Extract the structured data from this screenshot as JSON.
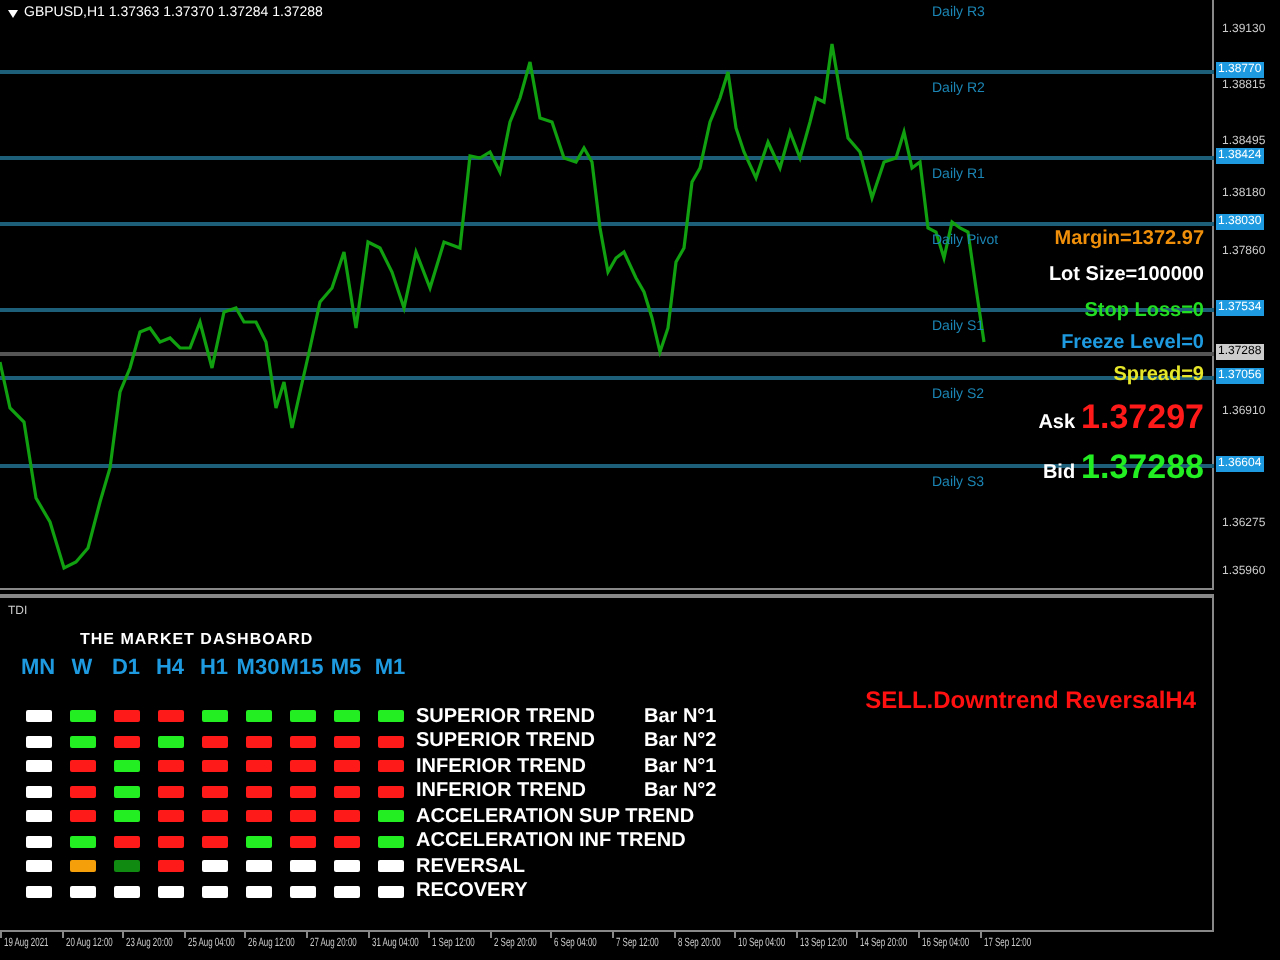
{
  "chart": {
    "title": "GBPUSD,H1 1.37363 1.37370 1.37284 1.37288",
    "pivots": [
      {
        "label": "Daily R3"
      },
      {
        "label": "Daily R2",
        "tag": "1.38770"
      },
      {
        "label": "Daily R1",
        "tag": "1.38424"
      },
      {
        "label": "Daily Pivot",
        "tag": "1.38030"
      },
      {
        "label": "Daily S1",
        "tag": "1.37534"
      },
      {
        "label": "Daily S2",
        "tag": "1.37056"
      },
      {
        "label": "Daily S3",
        "tag": "1.36604"
      }
    ],
    "current_price": {
      "tag": "1.37288"
    },
    "price_axis": [
      "1.39130",
      "1.38815",
      "1.38495",
      "1.38180",
      "1.37860",
      "1.36910",
      "1.36275",
      "1.35960"
    ],
    "info": [
      {
        "text": "Margin=1372.97",
        "color": "#f0900a"
      },
      {
        "text": "Lot Size=100000",
        "color": "#ffffff"
      },
      {
        "text": "Stop Loss=0",
        "color": "#22dd22"
      },
      {
        "text": "Freeze Level=0",
        "color": "#1e9be0"
      },
      {
        "text": "Spread=9",
        "color": "#e6e62a"
      }
    ],
    "quotes": [
      {
        "label": "Ask",
        "value": "1.37297",
        "color": "#ff1a1a"
      },
      {
        "label": "Bid",
        "value": "1.37288",
        "color": "#22ee22"
      }
    ]
  },
  "indicator": {
    "name": "TDI",
    "dashboard_title": "THE MARKET DASHBOARD",
    "timeframes": [
      "MN",
      "W",
      "D1",
      "H4",
      "H1",
      "M30",
      "M15",
      "M5",
      "M1"
    ],
    "rows": [
      {
        "name": "SUPERIOR TREND",
        "bar": "Bar N°1",
        "cells": [
          {
            "color": "#ffffff"
          },
          {
            "color": "#22ee22"
          },
          {
            "color": "#ff1a1a"
          },
          {
            "color": "#ff1a1a"
          },
          {
            "color": "#22ee22"
          },
          {
            "color": "#22ee22"
          },
          {
            "color": "#22ee22"
          },
          {
            "color": "#22ee22"
          },
          {
            "color": "#22ee22"
          }
        ]
      },
      {
        "name": "SUPERIOR TREND",
        "bar": "Bar N°2",
        "cells": [
          {
            "color": "#ffffff"
          },
          {
            "color": "#22ee22"
          },
          {
            "color": "#ff1a1a"
          },
          {
            "color": "#22ee22"
          },
          {
            "color": "#ff1a1a"
          },
          {
            "color": "#ff1a1a"
          },
          {
            "color": "#ff1a1a"
          },
          {
            "color": "#ff1a1a"
          },
          {
            "color": "#ff1a1a"
          }
        ]
      },
      {
        "name": "INFERIOR TREND",
        "bar": "Bar N°1",
        "cells": [
          {
            "color": "#ffffff"
          },
          {
            "color": "#ff1a1a"
          },
          {
            "color": "#22ee22"
          },
          {
            "color": "#ff1a1a"
          },
          {
            "color": "#ff1a1a"
          },
          {
            "color": "#ff1a1a"
          },
          {
            "color": "#ff1a1a"
          },
          {
            "color": "#ff1a1a"
          },
          {
            "color": "#ff1a1a"
          }
        ]
      },
      {
        "name": "INFERIOR TREND",
        "bar": "Bar N°2",
        "cells": [
          {
            "color": "#ffffff"
          },
          {
            "color": "#ff1a1a"
          },
          {
            "color": "#22ee22"
          },
          {
            "color": "#ff1a1a"
          },
          {
            "color": "#ff1a1a"
          },
          {
            "color": "#ff1a1a"
          },
          {
            "color": "#ff1a1a"
          },
          {
            "color": "#ff1a1a"
          },
          {
            "color": "#ff1a1a"
          }
        ]
      },
      {
        "name": "ACCELERATION SUP TREND",
        "cells": [
          {
            "color": "#ffffff"
          },
          {
            "color": "#ff1a1a"
          },
          {
            "color": "#22ee22"
          },
          {
            "color": "#ff1a1a"
          },
          {
            "color": "#ff1a1a"
          },
          {
            "color": "#ff1a1a"
          },
          {
            "color": "#ff1a1a"
          },
          {
            "color": "#ff1a1a"
          },
          {
            "color": "#22ee22"
          }
        ]
      },
      {
        "name": "ACCELERATION INF TREND",
        "cells": [
          {
            "color": "#ffffff"
          },
          {
            "color": "#22ee22"
          },
          {
            "color": "#ff1a1a"
          },
          {
            "color": "#ff1a1a"
          },
          {
            "color": "#ff1a1a"
          },
          {
            "color": "#22ee22"
          },
          {
            "color": "#ff1a1a"
          },
          {
            "color": "#ff1a1a"
          },
          {
            "color": "#22ee22"
          }
        ]
      },
      {
        "name": "REVERSAL",
        "cells": [
          {
            "color": "#ffffff"
          },
          {
            "color": "#f5a00a"
          },
          {
            "color": "#108a10"
          },
          {
            "color": "#ff1a1a"
          },
          {
            "color": "#ffffff"
          },
          {
            "color": "#ffffff"
          },
          {
            "color": "#ffffff"
          },
          {
            "color": "#ffffff"
          },
          {
            "color": "#ffffff"
          }
        ]
      },
      {
        "name": "RECOVERY",
        "cells": [
          {
            "color": "#ffffff"
          },
          {
            "color": "#ffffff"
          },
          {
            "color": "#ffffff"
          },
          {
            "color": "#ffffff"
          },
          {
            "color": "#ffffff"
          },
          {
            "color": "#ffffff"
          },
          {
            "color": "#ffffff"
          },
          {
            "color": "#ffffff"
          },
          {
            "color": "#ffffff"
          }
        ]
      }
    ],
    "signal": "SELL.Downtrend ReversalH4"
  },
  "time_axis": [
    "19 Aug 2021",
    "20 Aug 12:00",
    "23 Aug 20:00",
    "25 Aug 04:00",
    "26 Aug 12:00",
    "27 Aug 20:00",
    "31 Aug 04:00",
    "1 Sep 12:00",
    "2 Sep 20:00",
    "6 Sep 04:00",
    "7 Sep 12:00",
    "8 Sep 20:00",
    "10 Sep 04:00",
    "13 Sep 12:00",
    "14 Sep 20:00",
    "16 Sep 04:00",
    "17 Sep 12:00"
  ]
}
